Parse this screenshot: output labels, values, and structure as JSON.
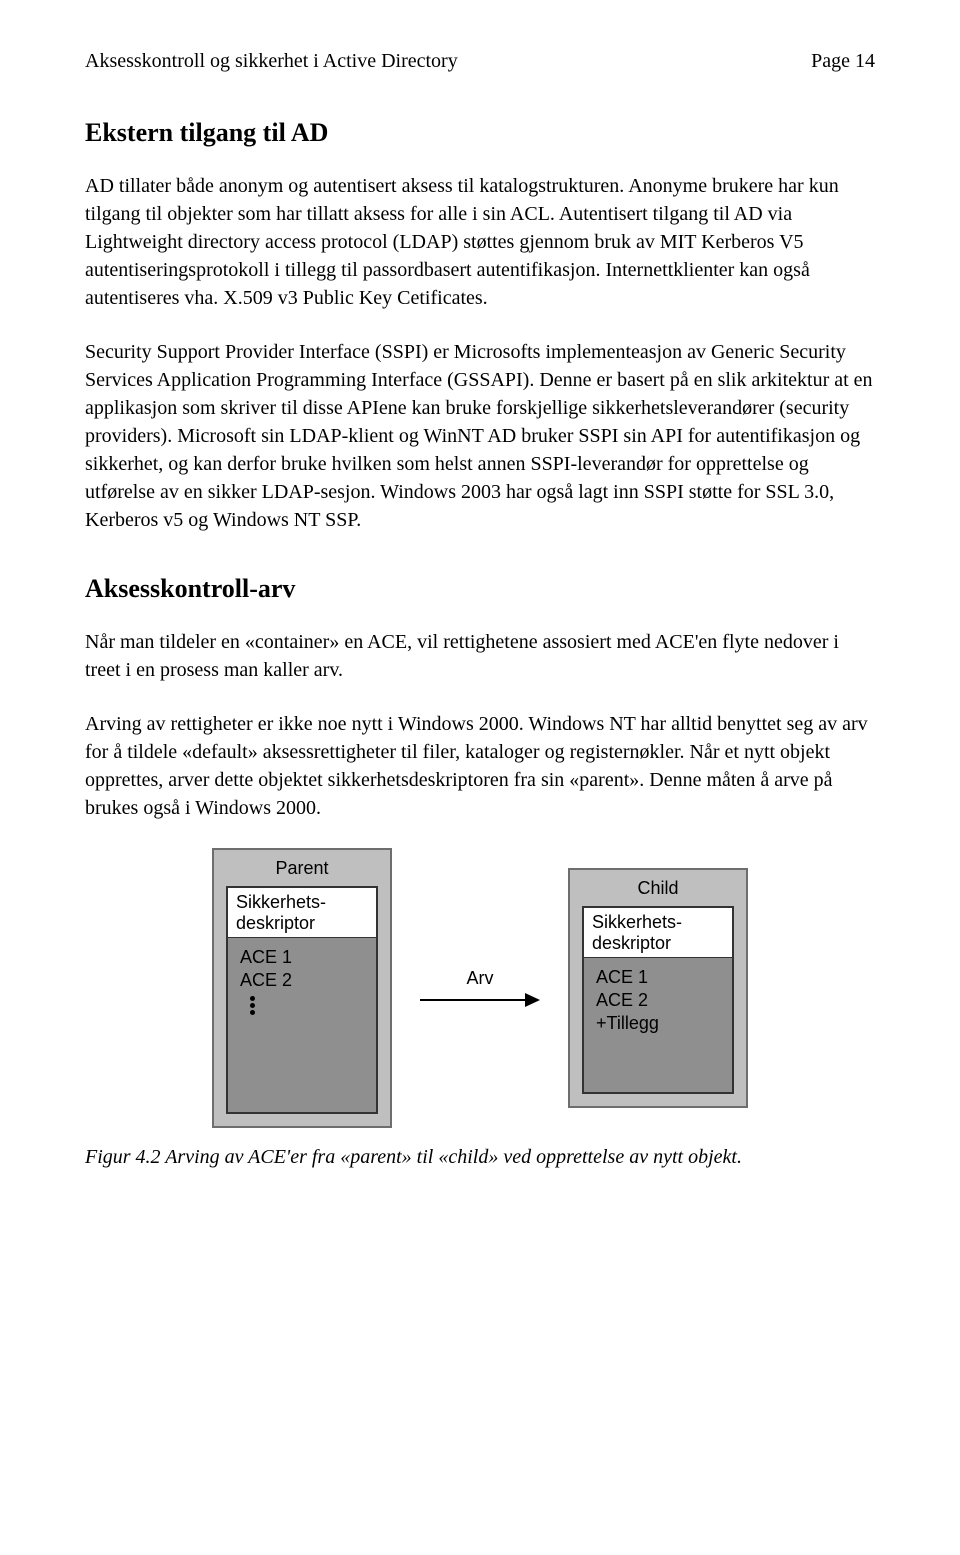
{
  "header": {
    "title": "Aksesskontroll og sikkerhet i Active Directory",
    "page_label": "Page 14"
  },
  "section1": {
    "title": "Ekstern tilgang til AD",
    "para1": "AD tillater både anonym og autentisert aksess til katalogstrukturen. Anonyme brukere har kun tilgang til objekter som har tillatt aksess for alle i sin ACL. Autentisert tilgang til AD via Lightweight directory access protocol (LDAP) støttes gjennom bruk av MIT Kerberos V5 autentiseringsprotokoll i tillegg til passordbasert autentifikasjon. Internettklienter kan også autentiseres vha. X.509 v3 Public Key Cetificates.",
    "para2_a": "Security Support Provider Interface (SSPI) er Microsofts implementeasjon av Generic Security Services Application Programming Interface (GSSAPI). Denne er basert på en slik arkitektur at en applikasjon som skriver til disse APIene kan bruke forskjellige sikkerhetsleverandører (security providers). Microsoft sin LDAP-klient og WinNT AD bruker SSPI sin API for autentifikasjon og sikkerhet, og kan derfor bruke hvilken som helst annen SSPI-leverandør for opprettelse og utførelse av en sikker LDAP-sesjon.",
    "para2_b": " Windows 2003 har også lagt inn SSPI støtte for SSL 3.0, Kerberos v5 og Windows NT SSP."
  },
  "section2": {
    "title": "Aksesskontroll-arv",
    "para1": "Når man tildeler en «container» en ACE, vil rettighetene assosiert med ACE'en flyte nedover i treet i en prosess man kaller arv.",
    "para2": "Arving av rettigheter er ikke noe nytt i Windows 2000. Windows NT har alltid benyttet seg av arv for å tildele «default» aksessrettigheter til filer, kataloger og registernøkler. Når et nytt objekt opprettes, arver dette objektet sikkerhetsdeskriptoren fra sin «parent». Denne måten å arve på brukes også i Windows 2000."
  },
  "figure": {
    "parent": {
      "title": "Parent",
      "sd_label_line1": "Sikkerhets-",
      "sd_label_line2": "deskriptor",
      "ace1": "ACE 1",
      "ace2": "ACE 2"
    },
    "arrow_label": "Arv",
    "child": {
      "title": "Child",
      "sd_label_line1": "Sikkerhets-",
      "sd_label_line2": "deskriptor",
      "ace1": "ACE 1",
      "ace2": "ACE 2",
      "ace3": "+Tillegg"
    },
    "caption": "Figur 4.2 Arving av ACE'er fra «parent» til «child» ved opprettelse av nytt objekt."
  }
}
